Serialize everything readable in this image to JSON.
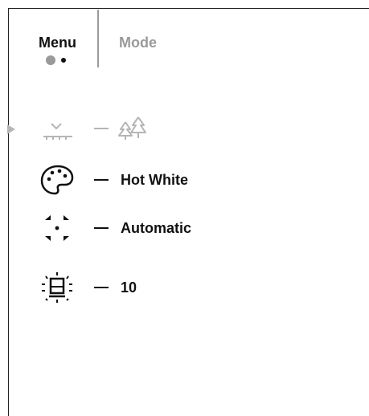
{
  "header": {
    "tabs": [
      {
        "label": "Menu",
        "active": true
      },
      {
        "label": "Mode",
        "active": false
      }
    ],
    "page_indicator": {
      "pages": 2,
      "current": 1
    }
  },
  "settings": [
    {
      "icon": "scene-mode-icon",
      "value_icon": "forest-icon",
      "value": "",
      "enabled": false,
      "selected": true
    },
    {
      "icon": "color-palette-icon",
      "value": "Hot White",
      "enabled": true,
      "selected": false
    },
    {
      "icon": "calibration-icon",
      "value": "Automatic",
      "enabled": true,
      "selected": false
    },
    {
      "icon": "brightness-icon",
      "value": "10",
      "enabled": true,
      "selected": false
    }
  ],
  "colors": {
    "text": "#111111",
    "disabled": "#9a9a9a",
    "background": "#ffffff"
  }
}
